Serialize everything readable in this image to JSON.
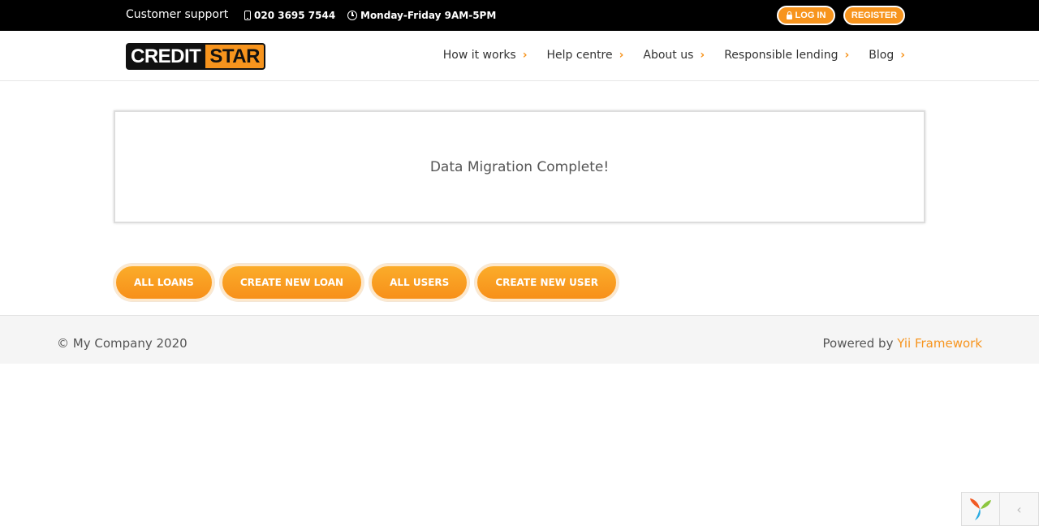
{
  "topbar": {
    "support": "Customer support",
    "phone": "020 3695 7544",
    "hours": "Monday-Friday 9AM-5PM",
    "login": "LOG IN",
    "register": "REGISTER"
  },
  "brand": {
    "logo_part1": "CREDIT",
    "logo_part2": "STAR"
  },
  "nav": {
    "items": [
      {
        "label": "How it works"
      },
      {
        "label": "Help centre"
      },
      {
        "label": "About us"
      },
      {
        "label": "Responsible lending"
      },
      {
        "label": "Blog"
      }
    ]
  },
  "panel": {
    "message": "Data Migration Complete!"
  },
  "actions": [
    {
      "label": "ALL LOANS"
    },
    {
      "label": "CREATE NEW LOAN"
    },
    {
      "label": "ALL USERS"
    },
    {
      "label": "CREATE NEW USER"
    }
  ],
  "footer": {
    "copyright": "© My Company 2020",
    "powered_prefix": "Powered by ",
    "powered_link": "Yii Framework"
  },
  "debug": {
    "toggle_glyph": "‹"
  },
  "colors": {
    "accent": "#f7941d",
    "topbar_bg": "#000000",
    "footer_bg": "#f5f5f5"
  }
}
